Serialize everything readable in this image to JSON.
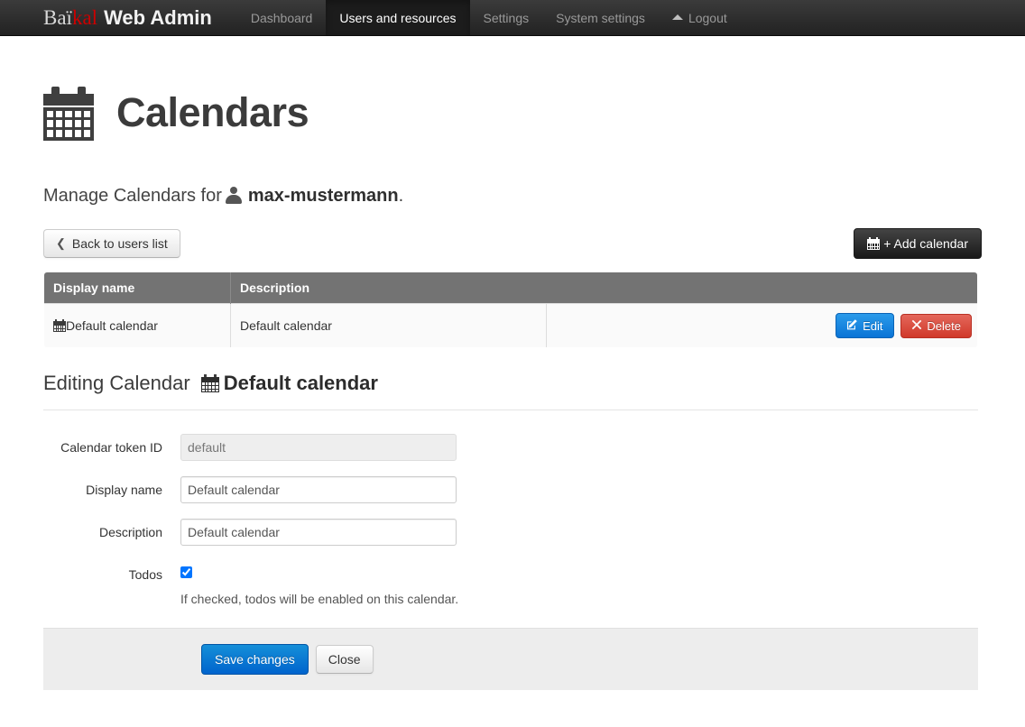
{
  "navbar": {
    "brand": {
      "part1": "Baïkal",
      "part_light": "Baï",
      "part_red": "kal",
      "suffix": "Web Admin"
    },
    "links": [
      {
        "label": "Dashboard",
        "active": false
      },
      {
        "label": "Users and resources",
        "active": true
      },
      {
        "label": "Settings",
        "active": false
      },
      {
        "label": "System settings",
        "active": false
      },
      {
        "label": "Logout",
        "active": false,
        "icon": "eject-icon"
      }
    ]
  },
  "page": {
    "icon": "calendar-icon",
    "title": "Calendars",
    "subtitle_prefix": "Manage Calendars for",
    "subtitle_user_icon": "user-icon",
    "subtitle_user": "max-mustermann",
    "subtitle_suffix": "."
  },
  "toolbar": {
    "back_icon": "chevron-left-icon",
    "back_label": "Back to users list",
    "add_icon": "calendar-icon",
    "add_label": "+ Add calendar"
  },
  "table": {
    "headers": [
      "Display name",
      "Description"
    ],
    "rows": [
      {
        "display_name": "Default calendar",
        "display_name_icon": "calendar-icon",
        "description": "Default calendar",
        "edit_icon": "pencil-square-icon",
        "edit_label": "Edit",
        "delete_icon": "x-mark-icon",
        "delete_label": "Delete"
      }
    ]
  },
  "editing": {
    "heading_prefix": "Editing Calendar",
    "heading_icon": "calendar-icon",
    "heading_name": "Default calendar"
  },
  "form": {
    "fields": [
      {
        "label": "Calendar token ID",
        "value": "default",
        "disabled": true
      },
      {
        "label": "Display name",
        "value": "Default calendar",
        "disabled": false
      },
      {
        "label": "Description",
        "value": "Default calendar",
        "disabled": false
      }
    ],
    "todos": {
      "label": "Todos",
      "checked": true,
      "help": "If checked, todos will be enabled on this calendar."
    },
    "actions": {
      "save_label": "Save changes",
      "close_label": "Close"
    }
  },
  "colors": {
    "navbar_bg": "#2c2c2c",
    "brand_red": "#cc0000",
    "primary": "#0064cd",
    "info": "#1a84e0",
    "danger": "#da4437",
    "table_header": "#737373",
    "footer_bg": "#ededed"
  }
}
